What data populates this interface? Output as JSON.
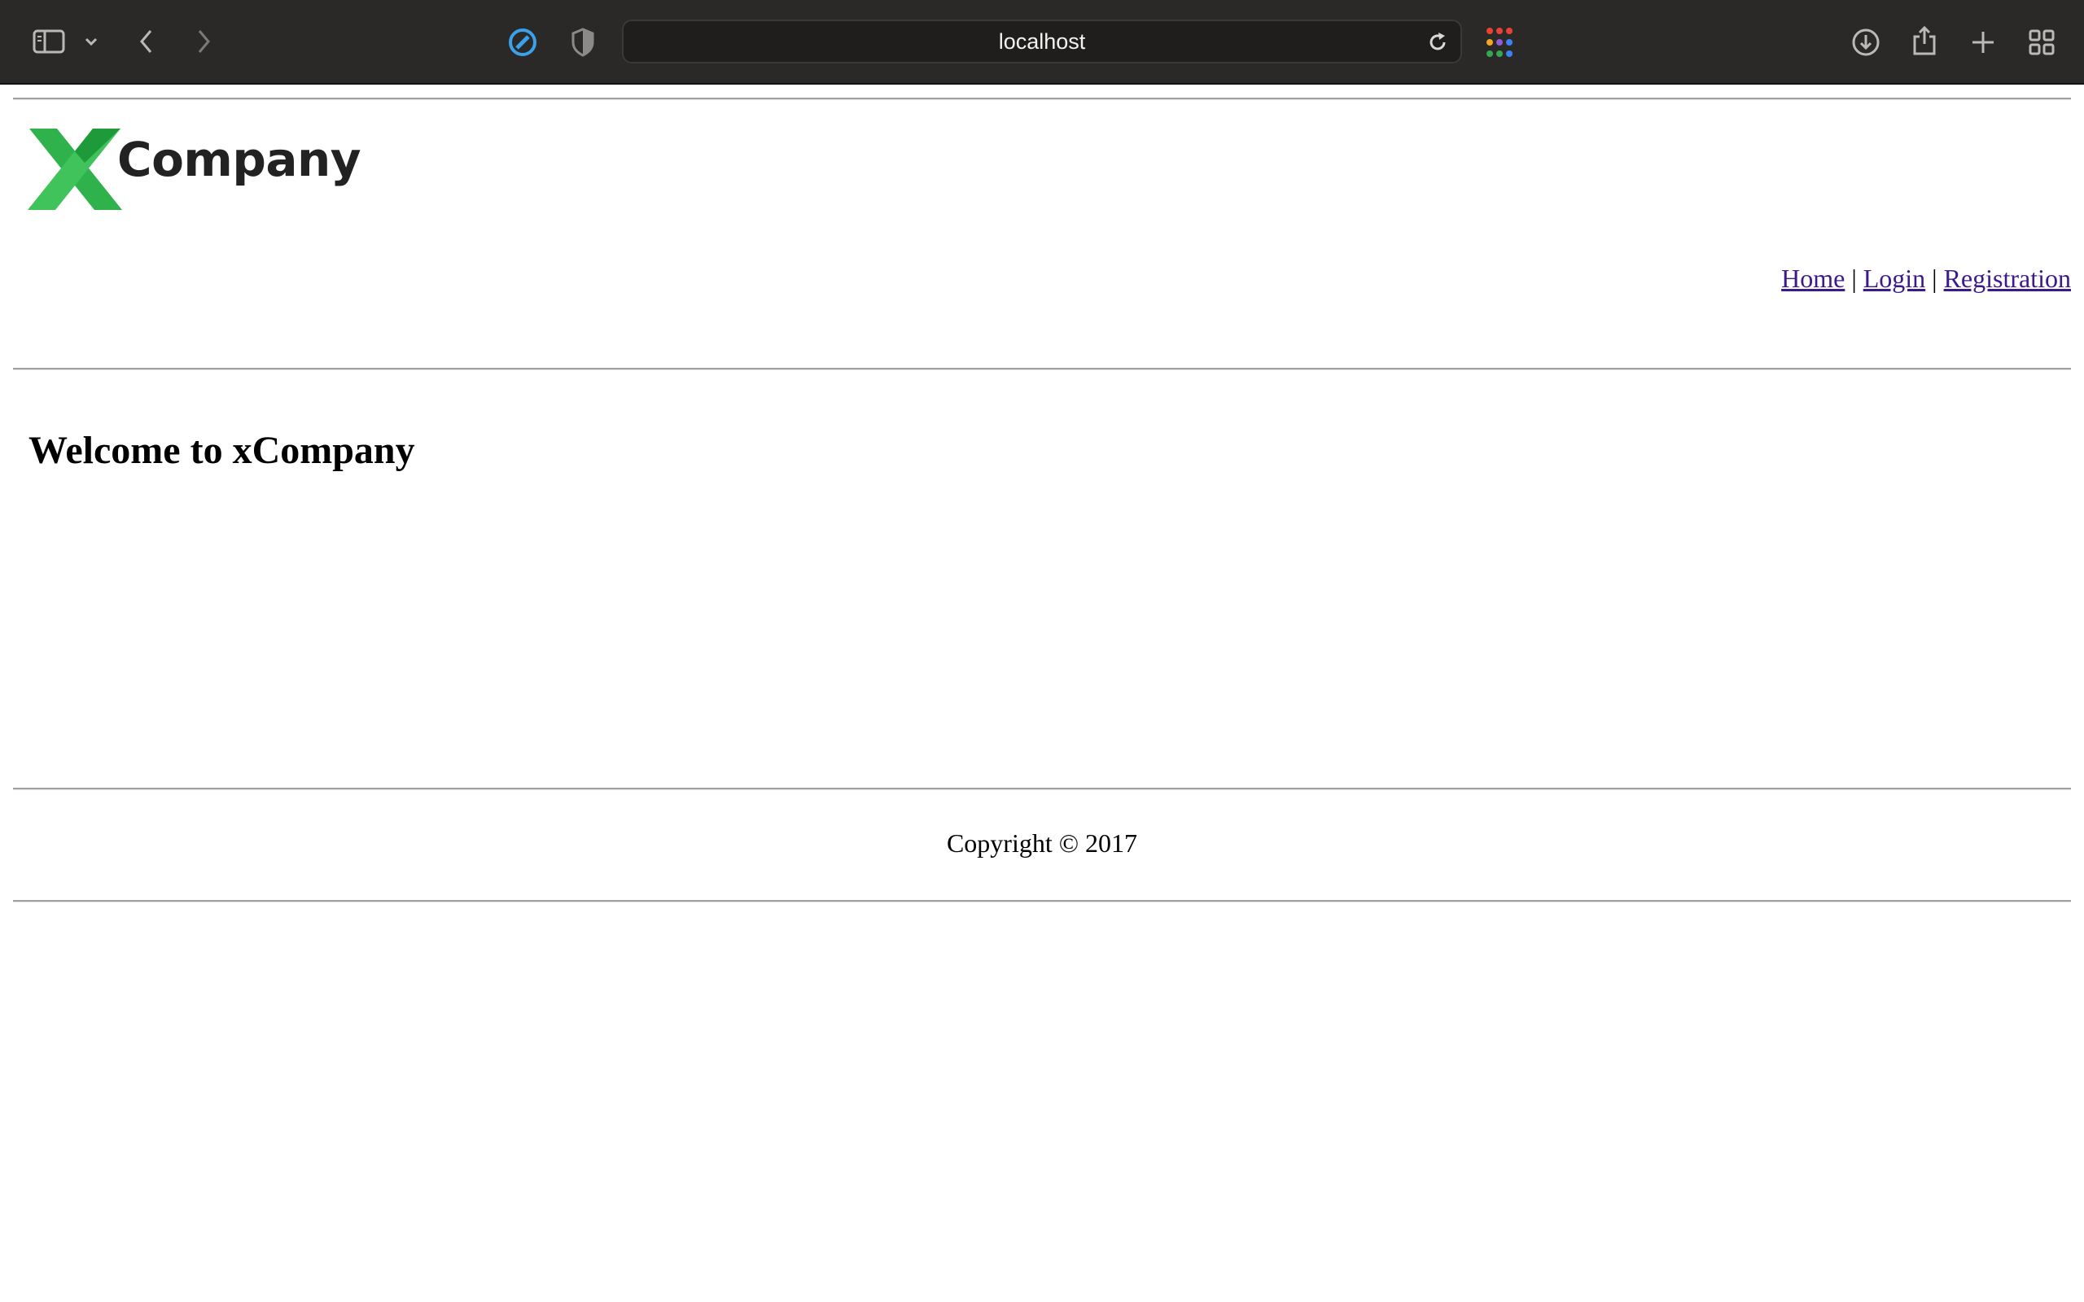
{
  "browser": {
    "url": "localhost",
    "icons": {
      "sidebar": "sidebar-icon",
      "sidebar_menu": "chevron-down-icon",
      "back": "chevron-left-icon",
      "forward": "chevron-right-icon",
      "extension": "compass-icon",
      "privacy": "shield-icon",
      "reload": "reload-icon",
      "apps": "grid-dots-icon",
      "downloads": "download-icon",
      "share": "share-icon",
      "new_tab": "plus-icon",
      "tabs": "tab-overview-icon"
    }
  },
  "page": {
    "logo": {
      "mark": "X",
      "text": "Company",
      "mark_color": "#2fb24c"
    },
    "nav": {
      "items": [
        "Home",
        "Login",
        "Registration"
      ],
      "separator": "|"
    },
    "heading": "Welcome to xCompany",
    "footer": "Copyright © 2017"
  }
}
